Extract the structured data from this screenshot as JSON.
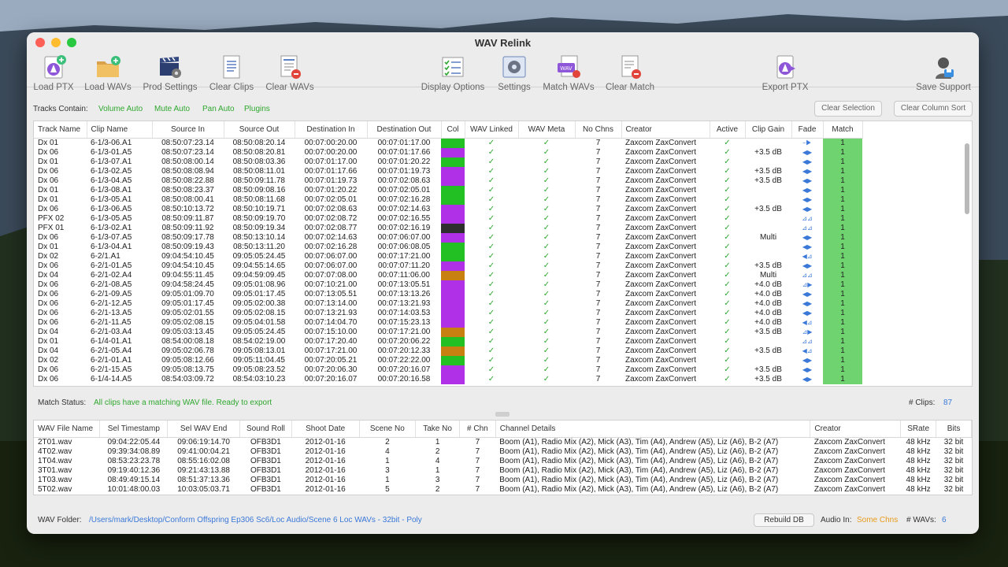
{
  "window": {
    "title": "WAV Relink"
  },
  "toolbar": {
    "load_ptx": "Load PTX",
    "load_wavs": "Load WAVs",
    "prod_settings": "Prod Settings",
    "clear_clips": "Clear Clips",
    "clear_wavs": "Clear WAVs",
    "display_options": "Display Options",
    "settings": "Settings",
    "match_wavs": "Match WAVs",
    "clear_match": "Clear Match",
    "export_ptx": "Export PTX",
    "save_support": "Save Support"
  },
  "filters": {
    "label": "Tracks Contain:",
    "options": [
      "Volume Auto",
      "Mute Auto",
      "Pan Auto",
      "Plugins"
    ],
    "clear_selection": "Clear Selection",
    "clear_column_sort": "Clear Column Sort"
  },
  "clips_table": {
    "headers": [
      "Track Name",
      "Clip Name",
      "Source In",
      "Source Out",
      "Destination In",
      "Destination Out",
      "Col",
      "WAV Linked",
      "WAV Meta",
      "No Chns",
      "Creator",
      "Active",
      "Clip Gain",
      "Fade",
      "Match"
    ],
    "rows": [
      [
        "Dx 01",
        "6-1/3-06.A1",
        "08:50:07:23.14",
        "08:50:08:20.14",
        "00:07:00:20.00",
        "00:07:01:17.00",
        "#22c022",
        "✓",
        "✓",
        "7",
        "Zaxcom ZaxConvert",
        "✓",
        "",
        "⎯▶",
        "1"
      ],
      [
        "Dx 06",
        "6-1/3-01.A5",
        "08:50:07:23.14",
        "08:50:08:20.81",
        "00:07:00:20.00",
        "00:07:01:17.66",
        "#b030e8",
        "✓",
        "✓",
        "7",
        "Zaxcom ZaxConvert",
        "✓",
        "+3.5 dB",
        "◀▶",
        "1"
      ],
      [
        "Dx 01",
        "6-1/3-07.A1",
        "08:50:08:00.14",
        "08:50:08:03.36",
        "00:07:01:17.00",
        "00:07:01:20.22",
        "#22c022",
        "✓",
        "✓",
        "7",
        "Zaxcom ZaxConvert",
        "✓",
        "",
        "◀▶",
        "1"
      ],
      [
        "Dx 06",
        "6-1/3-02.A5",
        "08:50:08:08.94",
        "08:50:08:11.01",
        "00:07:01:17.66",
        "00:07:01:19.73",
        "#b030e8",
        "✓",
        "✓",
        "7",
        "Zaxcom ZaxConvert",
        "✓",
        "+3.5 dB",
        "◀▶",
        "1"
      ],
      [
        "Dx 06",
        "6-1/3-04.A5",
        "08:50:08:22.88",
        "08:50:09:11.78",
        "00:07:01:19.73",
        "00:07:02:08.63",
        "#b030e8",
        "✓",
        "✓",
        "7",
        "Zaxcom ZaxConvert",
        "✓",
        "+3.5 dB",
        "◀▶",
        "1"
      ],
      [
        "Dx 01",
        "6-1/3-08.A1",
        "08:50:08:23.37",
        "08:50:09:08.16",
        "00:07:01:20.22",
        "00:07:02:05.01",
        "#22c022",
        "✓",
        "✓",
        "7",
        "Zaxcom ZaxConvert",
        "✓",
        "",
        "◀▶",
        "1"
      ],
      [
        "Dx 01",
        "6-1/3-05.A1",
        "08:50:08:00.41",
        "08:50:08:11.68",
        "00:07:02:05.01",
        "00:07:02:16.28",
        "#22c022",
        "✓",
        "✓",
        "7",
        "Zaxcom ZaxConvert",
        "✓",
        "",
        "◀▶",
        "1"
      ],
      [
        "Dx 06",
        "6-1/3-06.A5",
        "08:50:10:13.72",
        "08:50:10:19.71",
        "00:07:02:08.63",
        "00:07:02:14.63",
        "#b030e8",
        "✓",
        "✓",
        "7",
        "Zaxcom ZaxConvert",
        "✓",
        "+3.5 dB",
        "◀▶",
        "1"
      ],
      [
        "PFX 02",
        "6-1/3-05.A5",
        "08:50:09:11.87",
        "08:50:09:19.70",
        "00:07:02:08.72",
        "00:07:02:16.55",
        "#b030e8",
        "✓",
        "✓",
        "7",
        "Zaxcom ZaxConvert",
        "✓",
        "",
        "⊿⊿",
        "1"
      ],
      [
        "PFX 01",
        "6-1/3-02.A1",
        "08:50:09:11.92",
        "08:50:09:19.34",
        "00:07:02:08.77",
        "00:07:02:16.19",
        "#2e2e2e",
        "✓",
        "✓",
        "7",
        "Zaxcom ZaxConvert",
        "✓",
        "",
        "⊿⊿",
        "1"
      ],
      [
        "Dx 06",
        "6-1/3-07.A5",
        "08:50:09:17.78",
        "08:50:13:10.14",
        "00:07:02:14.63",
        "00:07:06:07.00",
        "#b030e8",
        "✓",
        "✓",
        "7",
        "Zaxcom ZaxConvert",
        "✓",
        "Multi",
        "◀▶",
        "1"
      ],
      [
        "Dx 01",
        "6-1/3-04.A1",
        "08:50:09:19.43",
        "08:50:13:11.20",
        "00:07:02:16.28",
        "00:07:06:08.05",
        "#22c022",
        "✓",
        "✓",
        "7",
        "Zaxcom ZaxConvert",
        "✓",
        "",
        "◀▶",
        "1"
      ],
      [
        "Dx 02",
        "6-2/1.A1",
        "09:04:54:10.45",
        "09:05:05:24.45",
        "00:07:06:07.00",
        "00:07:17:21.00",
        "#22c022",
        "✓",
        "✓",
        "7",
        "Zaxcom ZaxConvert",
        "✓",
        "",
        "◀⊿",
        "1"
      ],
      [
        "Dx 06",
        "6-2/1-01.A5",
        "09:04:54:10.45",
        "09:04:55:14.65",
        "00:07:06:07.00",
        "00:07:07:11.20",
        "#b030e8",
        "✓",
        "✓",
        "7",
        "Zaxcom ZaxConvert",
        "✓",
        "+3.5 dB",
        "◀▶",
        "1"
      ],
      [
        "Dx 04",
        "6-2/1-02.A4",
        "09:04:55:11.45",
        "09:04:59:09.45",
        "00:07:07:08.00",
        "00:07:11:06.00",
        "#c88010",
        "✓",
        "✓",
        "7",
        "Zaxcom ZaxConvert",
        "✓",
        "Multi",
        "⊿⊿",
        "1"
      ],
      [
        "Dx 06",
        "6-2/1-08.A5",
        "09:04:58:24.45",
        "09:05:01:08.96",
        "00:07:10:21.00",
        "00:07:13:05.51",
        "#b030e8",
        "✓",
        "✓",
        "7",
        "Zaxcom ZaxConvert",
        "✓",
        "+4.0 dB",
        "⊿▶",
        "1"
      ],
      [
        "Dx 06",
        "6-2/1-09.A5",
        "09:05:01:09.70",
        "09:05:01:17.45",
        "00:07:13:05.51",
        "00:07:13:13.26",
        "#b030e8",
        "✓",
        "✓",
        "7",
        "Zaxcom ZaxConvert",
        "✓",
        "+4.0 dB",
        "◀▶",
        "1"
      ],
      [
        "Dx 06",
        "6-2/1-12.A5",
        "09:05:01:17.45",
        "09:05:02:00.38",
        "00:07:13:14.00",
        "00:07:13:21.93",
        "#b030e8",
        "✓",
        "✓",
        "7",
        "Zaxcom ZaxConvert",
        "✓",
        "+4.0 dB",
        "◀▶",
        "1"
      ],
      [
        "Dx 06",
        "6-2/1-13.A5",
        "09:05:02:01.55",
        "09:05:02:08.15",
        "00:07:13:21.93",
        "00:07:14:03.53",
        "#b030e8",
        "✓",
        "✓",
        "7",
        "Zaxcom ZaxConvert",
        "✓",
        "+4.0 dB",
        "◀▶",
        "1"
      ],
      [
        "Dx 06",
        "6-2/1-11.A5",
        "09:05:02:08.15",
        "09:05:04:01.58",
        "00:07:14:04.70",
        "00:07:15:23.13",
        "#b030e8",
        "✓",
        "✓",
        "7",
        "Zaxcom ZaxConvert",
        "✓",
        "+4.0 dB",
        "◀⊿",
        "1"
      ],
      [
        "Dx 04",
        "6-2/1-03.A4",
        "09:05:03:13.45",
        "09:05:05:24.45",
        "00:07:15:10.00",
        "00:07:17:21.00",
        "#c88010",
        "✓",
        "✓",
        "7",
        "Zaxcom ZaxConvert",
        "✓",
        "+3.5 dB",
        "⊿▶",
        "1"
      ],
      [
        "Dx 01",
        "6-1/4-01.A1",
        "08:54:00:08.18",
        "08:54:02:19.00",
        "00:07:17:20.40",
        "00:07:20:06.22",
        "#22c022",
        "✓",
        "✓",
        "7",
        "Zaxcom ZaxConvert",
        "✓",
        "",
        "⊿⊿",
        "1"
      ],
      [
        "Dx 04",
        "6-2/1-05.A4",
        "09:05:02:06.78",
        "09:05:08:13.01",
        "00:07:17:21.00",
        "00:07:20:12.33",
        "#c88010",
        "✓",
        "✓",
        "7",
        "Zaxcom ZaxConvert",
        "✓",
        "+3.5 dB",
        "◀⊿",
        "1"
      ],
      [
        "Dx 02",
        "6-2/1-01.A1",
        "09:05:08:12.66",
        "09:05:11:04.45",
        "00:07:20:05.21",
        "00:07:22:22.00",
        "#22c022",
        "✓",
        "✓",
        "7",
        "Zaxcom ZaxConvert",
        "✓",
        "",
        "◀▶",
        "1"
      ],
      [
        "Dx 06",
        "6-2/1-15.A5",
        "09:05:08:13.75",
        "09:05:08:23.52",
        "00:07:20:06.30",
        "00:07:20:16.07",
        "#b030e8",
        "✓",
        "✓",
        "7",
        "Zaxcom ZaxConvert",
        "✓",
        "+3.5 dB",
        "◀▶",
        "1"
      ],
      [
        "Dx 06",
        "6-1/4-14.A5",
        "08:54:03:09.72",
        "08:54:03:10.23",
        "00:07:20:16.07",
        "00:07:20:16.58",
        "#b030e8",
        "✓",
        "✓",
        "7",
        "Zaxcom ZaxConvert",
        "✓",
        "+3.5 dB",
        "◀▶",
        "1"
      ]
    ]
  },
  "status": {
    "label": "Match Status:",
    "text": "All clips have a matching WAV file. Ready to export",
    "clips_label": "# Clips:",
    "clips_count": "87"
  },
  "wav_table": {
    "headers": [
      "WAV File Name",
      "Sel Timestamp",
      "Sel WAV End",
      "Sound Roll",
      "Shoot Date",
      "Scene No",
      "Take No",
      "# Chn",
      "Channel Details",
      "Creator",
      "SRate",
      "Bits"
    ],
    "rows": [
      [
        "2T01.wav",
        "09:04:22:05.44",
        "09:06:19:14.70",
        "OFB3D1",
        "2012-01-16",
        "2",
        "1",
        "7",
        "Boom (A1), Radio Mix (A2), Mick (A3), Tim (A4), Andrew (A5), Liz (A6), B-2 (A7)",
        "Zaxcom ZaxConvert",
        "48 kHz",
        "32 bit"
      ],
      [
        "4T02.wav",
        "09:39:34:08.89",
        "09:41:00:04.21",
        "OFB3D1",
        "2012-01-16",
        "4",
        "2",
        "7",
        "Boom (A1), Radio Mix (A2), Mick (A3), Tim (A4), Andrew (A5), Liz (A6), B-2 (A7)",
        "Zaxcom ZaxConvert",
        "48 kHz",
        "32 bit"
      ],
      [
        "1T04.wav",
        "08:53:23:23.78",
        "08:55:16:02.08",
        "OFB3D1",
        "2012-01-16",
        "1",
        "4",
        "7",
        "Boom (A1), Radio Mix (A2), Mick (A3), Tim (A4), Andrew (A5), Liz (A6), B-2 (A7)",
        "Zaxcom ZaxConvert",
        "48 kHz",
        "32 bit"
      ],
      [
        "3T01.wav",
        "09:19:40:12.36",
        "09:21:43:13.88",
        "OFB3D1",
        "2012-01-16",
        "3",
        "1",
        "7",
        "Boom (A1), Radio Mix (A2), Mick (A3), Tim (A4), Andrew (A5), Liz (A6), B-2 (A7)",
        "Zaxcom ZaxConvert",
        "48 kHz",
        "32 bit"
      ],
      [
        "1T03.wav",
        "08:49:49:15.14",
        "08:51:37:13.36",
        "OFB3D1",
        "2012-01-16",
        "1",
        "3",
        "7",
        "Boom (A1), Radio Mix (A2), Mick (A3), Tim (A4), Andrew (A5), Liz (A6), B-2 (A7)",
        "Zaxcom ZaxConvert",
        "48 kHz",
        "32 bit"
      ],
      [
        "5T02.wav",
        "10:01:48:00.03",
        "10:03:05:03.71",
        "OFB3D1",
        "2012-01-16",
        "5",
        "2",
        "7",
        "Boom (A1), Radio Mix (A2), Mick (A3), Tim (A4), Andrew (A5), Liz (A6), B-2 (A7)",
        "Zaxcom ZaxConvert",
        "48 kHz",
        "32 bit"
      ]
    ]
  },
  "footer": {
    "wav_folder_label": "WAV Folder:",
    "wav_folder_path": "/Users/mark/Desktop/Conform Offspring Ep306 Sc6/Loc Audio/Scene 6 Loc WAVs - 32bit - Poly",
    "rebuild_db": "Rebuild DB",
    "audio_in_label": "Audio In:",
    "audio_in_value": "Some Chns",
    "wavs_label": "# WAVs:",
    "wavs_count": "6"
  },
  "colors": {
    "accent_green": "#2fa82f",
    "link_blue": "#3a78d8",
    "orange": "#e89a1c",
    "match_green": "#6fd36f"
  }
}
